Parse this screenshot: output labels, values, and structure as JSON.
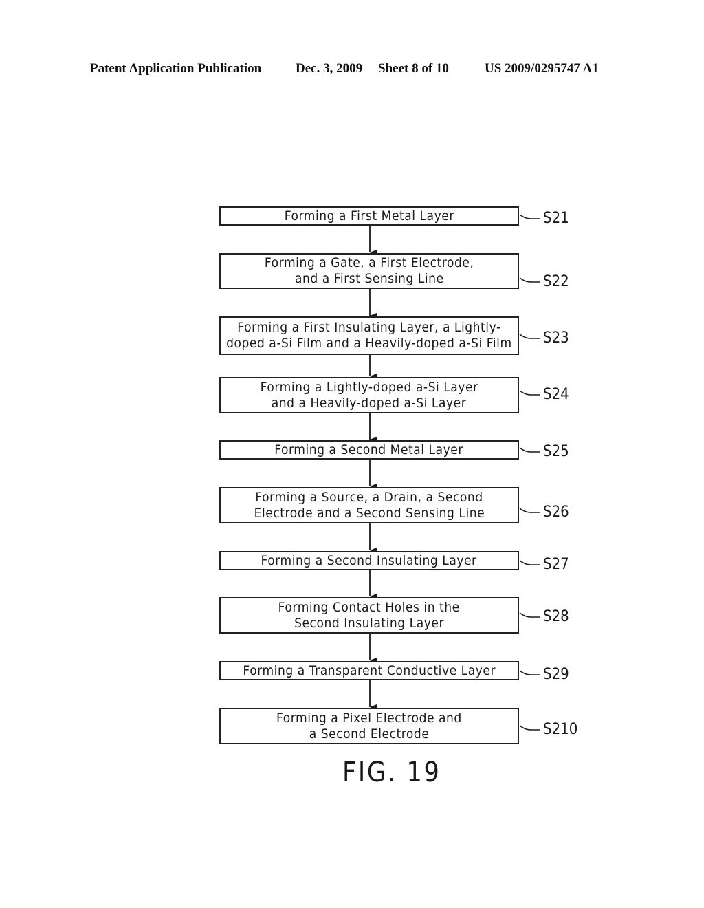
{
  "header": {
    "publication": "Patent Application Publication",
    "date": "Dec. 3, 2009",
    "sheet": "Sheet 8 of 10",
    "number": "US 2009/0295747 A1"
  },
  "steps": [
    {
      "id": "S21",
      "lines": [
        "Forming a First Metal Layer"
      ]
    },
    {
      "id": "S22",
      "lines": [
        "Forming a Gate, a First Electrode,",
        "and a First Sensing Line"
      ]
    },
    {
      "id": "S23",
      "lines": [
        "Forming a First Insulating Layer, a Lightly-",
        "doped a-Si Film and a Heavily-doped a-Si Film"
      ]
    },
    {
      "id": "S24",
      "lines": [
        "Forming a Lightly-doped a-Si Layer",
        "and a Heavily-doped a-Si Layer"
      ]
    },
    {
      "id": "S25",
      "lines": [
        "Forming a Second Metal Layer"
      ]
    },
    {
      "id": "S26",
      "lines": [
        "Forming a Source, a Drain, a Second",
        "Electrode and a Second Sensing Line"
      ]
    },
    {
      "id": "S27",
      "lines": [
        "Forming a Second Insulating Layer"
      ]
    },
    {
      "id": "S28",
      "lines": [
        "Forming Contact Holes in the",
        "Second Insulating Layer"
      ]
    },
    {
      "id": "S29",
      "lines": [
        "Forming a Transparent Conductive Layer"
      ]
    },
    {
      "id": "S210",
      "lines": [
        "Forming a Pixel Electrode and",
        "a Second Electrode"
      ]
    }
  ],
  "figure_label": "FIG. 19"
}
